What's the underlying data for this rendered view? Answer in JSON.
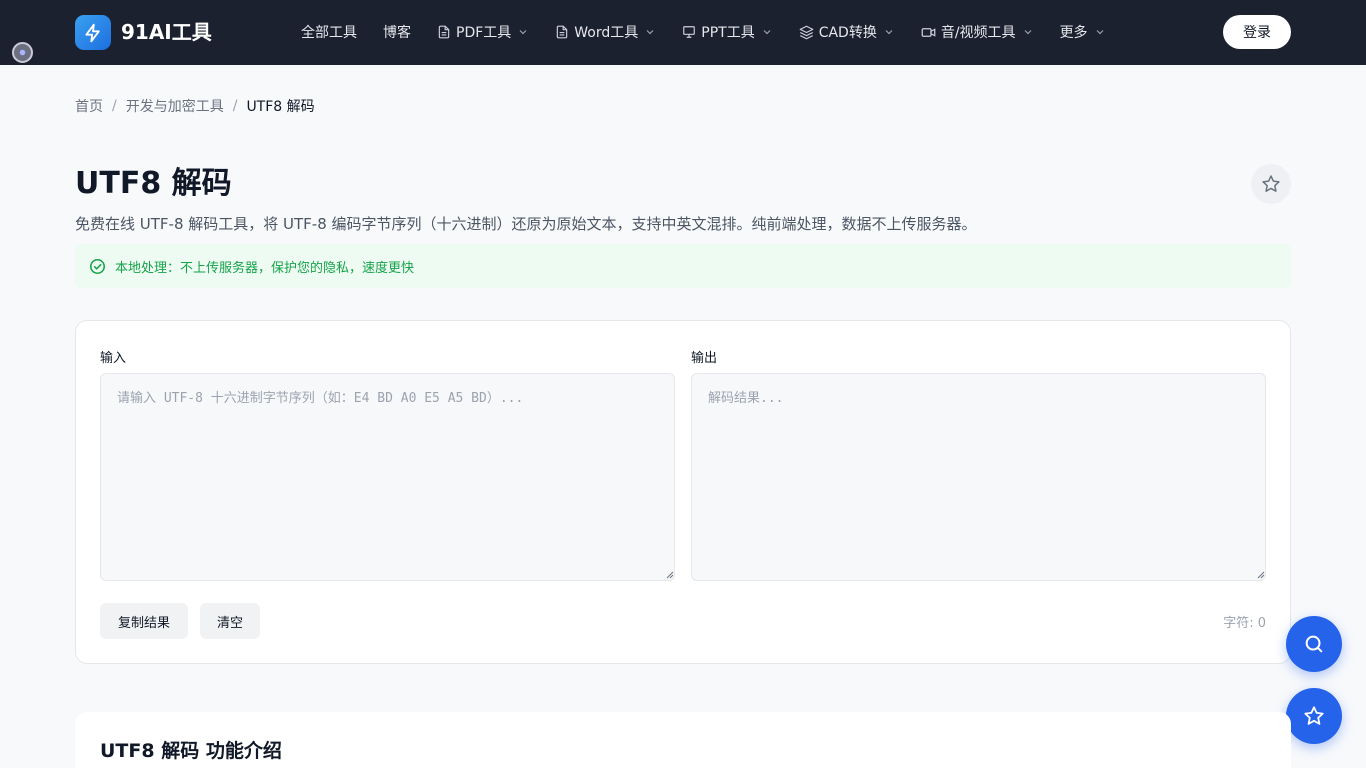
{
  "header": {
    "brand": "91AI工具",
    "login_label": "登录",
    "nav": [
      {
        "label": "全部工具"
      },
      {
        "label": "博客"
      },
      {
        "label": "PDF工具"
      },
      {
        "label": "Word工具"
      },
      {
        "label": "PPT工具"
      },
      {
        "label": "CAD转换"
      },
      {
        "label": "音/视频工具"
      },
      {
        "label": "更多"
      }
    ]
  },
  "breadcrumb": {
    "items": [
      "首页",
      "开发与加密工具",
      "UTF8 解码"
    ],
    "separator": "/"
  },
  "page": {
    "title": "UTF8 解码",
    "description": "免费在线 UTF-8 解码工具，将 UTF-8 编码字节序列（十六进制）还原为原始文本，支持中英文混排。纯前端处理，数据不上传服务器。",
    "notice": "本地处理：不上传服务器，保护您的隐私，速度更快"
  },
  "tool": {
    "input_label": "输入",
    "input_placeholder": "请输入 UTF-8 十六进制字节序列（如：E4 BD A0 E5 A5 BD）...",
    "input_value": "",
    "output_label": "输出",
    "output_placeholder": "解码结果...",
    "output_value": "",
    "copy_label": "复制结果",
    "clear_label": "清空",
    "char_count": "字符: 0"
  },
  "intro": {
    "title": "UTF8 解码 功能介绍"
  },
  "colors": {
    "header_bg": "#1c2130",
    "accent": "#2563eb",
    "success": "#16a34a",
    "notice_bg": "#eefbf2"
  }
}
